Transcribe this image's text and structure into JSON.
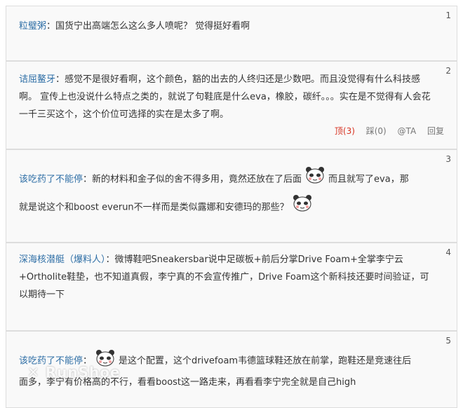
{
  "comments": [
    {
      "floor": "1",
      "author": "粒璧粥",
      "sep": "：",
      "text": "国货宁出高端怎么这么多人喷呢？ 觉得挺好看啊"
    },
    {
      "floor": "2",
      "author": "诘屈鳌牙",
      "sep": "：",
      "text": "感觉不是很好看啊，这个颜色，豁的出去的人终归还是少数吧。而且没觉得有什么科技感啊。 宣传上也没说什么特点之类的，就说了句鞋底是什么eva，橡胶，碳纤。。。实在是不觉得有人会花一千三买这个，这个价位可选择的实在是太多了啊。",
      "actions": {
        "up": "顶(3)",
        "down": "踩(0)",
        "at": "@TA",
        "reply": "回复"
      }
    },
    {
      "floor": "3",
      "author": "该吃药了不能停",
      "sep": "：",
      "text_a": "新的材料和金子似的舍不得多用，竟然还放在了后面",
      "text_b": "而且就写了eva，那",
      "text_c": "就是说这个和boost everun不一样而是类似露娜和安德玛的那些？",
      "emoji": "panda-emoji"
    },
    {
      "floor": "4",
      "author": "深海核潜艇（爆料人）",
      "sep": "：",
      "text": "微博鞋吧Sneakersbar说中足碳板+前后分掌Drive Foam+全掌李宁云+Ortholite鞋垫，也不知道真假，李宁真的不会宣传推广，Drive Foam这个新科技还要时间验证，可以期待一下"
    },
    {
      "floor": "5",
      "author": "该吃药了不能停",
      "sep": "：",
      "text_a": "是这个配置，这个drivefoam韦德篮球鞋还放在前掌，跑鞋还是竞速往后",
      "text_b": "面多，李宁有价格高的不行，看看boost这一路走来，再看看李宁完全就是自己high",
      "emoji": "panda-emoji"
    }
  ],
  "watermark": "✕ RunShoe"
}
